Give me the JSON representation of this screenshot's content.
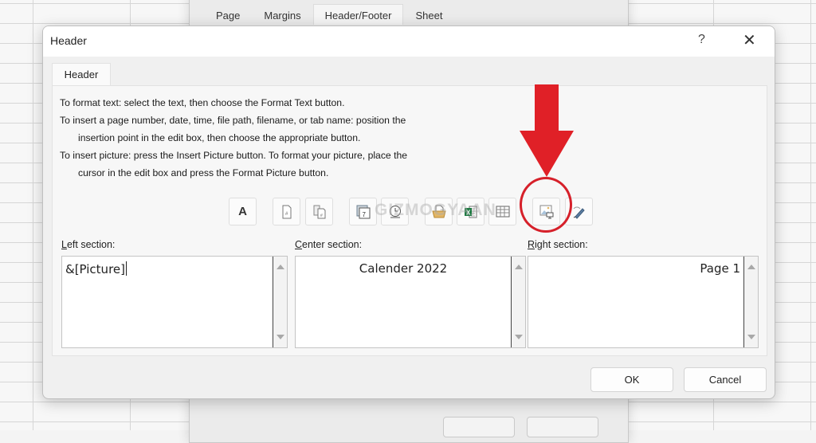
{
  "background_dialog": {
    "tabs": [
      "Page",
      "Margins",
      "Header/Footer",
      "Sheet"
    ],
    "active_tab": "Header/Footer"
  },
  "dialog": {
    "title": "Header",
    "help_label": "?",
    "close_label": "✕",
    "tab_label": "Header",
    "instructions": [
      "To format text:  select the text, then choose the Format Text button.",
      "To insert a page number, date, time, file path, filename, or tab name:  position the",
      "insertion point in the edit box, then choose the appropriate button.",
      "To insert picture: press the Insert Picture button.  To format your picture, place the",
      "cursor in the edit box and press the Format Picture button."
    ],
    "toolbar": [
      {
        "name": "format-text",
        "icon": "format-text-icon",
        "glyph": "A"
      },
      {
        "name": "insert-page-number",
        "icon": "page-number-icon"
      },
      {
        "name": "insert-number-of-pages",
        "icon": "number-of-pages-icon"
      },
      {
        "name": "insert-date",
        "icon": "calendar-icon"
      },
      {
        "name": "insert-time",
        "icon": "clock-icon"
      },
      {
        "name": "insert-file-path",
        "icon": "folder-path-icon"
      },
      {
        "name": "insert-file-name",
        "icon": "excel-file-icon"
      },
      {
        "name": "insert-sheet-name",
        "icon": "sheet-grid-icon"
      },
      {
        "name": "insert-picture",
        "icon": "insert-picture-icon",
        "highlighted": true
      },
      {
        "name": "format-picture",
        "icon": "format-picture-icon"
      }
    ],
    "sections": {
      "left": {
        "label_prefix": "L",
        "label_rest": "eft section:",
        "value": "&[Picture]"
      },
      "center": {
        "label_prefix": "C",
        "label_rest": "enter section:",
        "value": "Calender 2022"
      },
      "right": {
        "label_prefix": "R",
        "label_rest": "ight section:",
        "value": "Page 1"
      }
    },
    "ok_label": "OK",
    "cancel_label": "Cancel"
  },
  "annotation": {
    "color": "#d6202a",
    "target": "insert-picture"
  },
  "watermark": "GIZMOGYAAN"
}
